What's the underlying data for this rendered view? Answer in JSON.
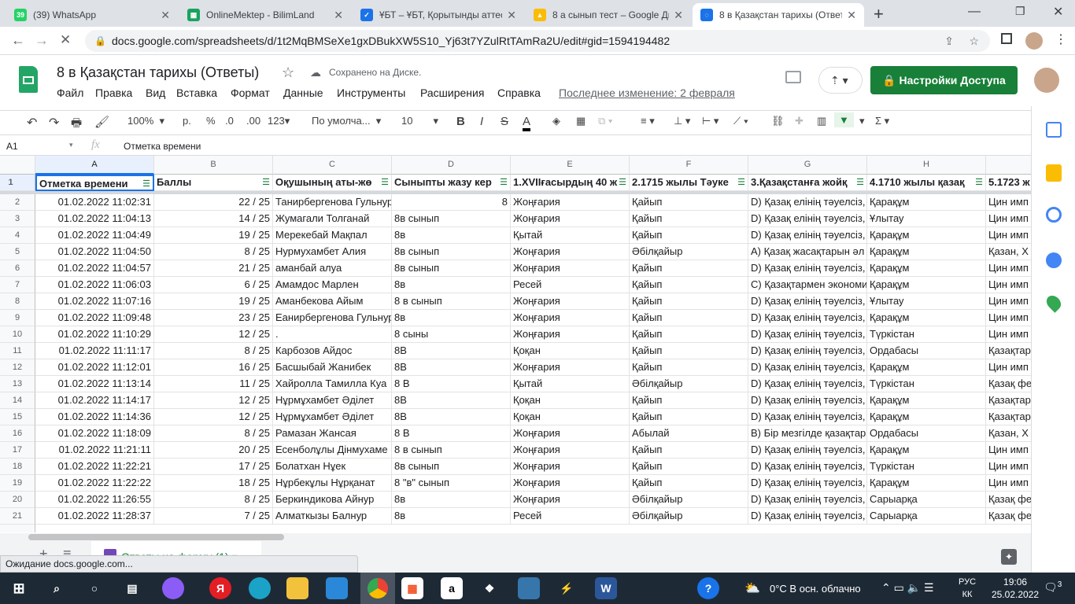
{
  "browser": {
    "tabs": [
      {
        "label": "(39) WhatsApp",
        "color": "#25d366",
        "glyph": "39"
      },
      {
        "label": "OnlineMektep - BilimLand",
        "color": "#1aa260",
        "glyph": "▦"
      },
      {
        "label": "ҰБТ – ҰБТ, Қорытынды аттес",
        "color": "#1a73e8",
        "glyph": "✓"
      },
      {
        "label": "8 а сынып тест – Google Ди",
        "color": "#fbbc04",
        "glyph": "▲"
      },
      {
        "label": "8 в Қазақстан тарихы (Ответ",
        "color": "#1a73e8",
        "glyph": "◌"
      }
    ],
    "url": "docs.google.com/spreadsheets/d/1t2MqBMSeXe1gxDBukXW5S10_Yj63t7YZulRtTAmRa2U/edit#gid=1594194482"
  },
  "doc": {
    "title": "8 в Қазақстан тарихы (Ответы)",
    "saved": "Сохранено на Диске.",
    "last_edit": "Последнее изменение: 2 февраля",
    "share": "Настройки Доступа",
    "menu": [
      "Файл",
      "Правка",
      "Вид",
      "Вставка",
      "Формат",
      "Данные",
      "Инструменты",
      "Расширения",
      "Справка"
    ]
  },
  "toolbar": {
    "zoom": "100%",
    "currency": "р.",
    "percent": "%",
    "dec_minus": ".0",
    "dec_plus": ".00",
    "format": "123",
    "font": "По умолча...",
    "size": "10",
    "bold": "B",
    "italic": "I",
    "strike": "S",
    "textcolor": "A"
  },
  "formula": {
    "cell": "A1",
    "fx": "fx",
    "value": "Отметка времени"
  },
  "columns": [
    "A",
    "B",
    "C",
    "D",
    "E",
    "F",
    "G",
    "H",
    "I"
  ],
  "headers": [
    "Отметка времени",
    "Баллы",
    "Оқушының аты-жө",
    "Сыныпты жазу  кер",
    "1.XVIIғасырдың 40 ж",
    "2.1715 жылы Тәуке",
    "3.Қазақстанға жойқ",
    "4.1710 жылы қазақ",
    "5.1723 ж"
  ],
  "rows": [
    [
      "2",
      "01.02.2022 11:02:31",
      "22 / 25",
      "Танирбергенова  Гульнур",
      "8",
      "Жоңғария",
      "Қайып",
      "D) Қазақ елінің тәуелсіз,",
      "Қарақұм",
      "Цин имп"
    ],
    [
      "3",
      "01.02.2022 11:04:13",
      "14 / 25",
      "Жумагали Толганай",
      "8в сынып",
      "Жоңғария",
      "Қайып",
      "D) Қазақ елінің тәуелсіз,",
      "Ұлытау",
      "Цин имп"
    ],
    [
      "4",
      "01.02.2022 11:04:49",
      "19 / 25",
      "Мерекебай Мақпал",
      "8в",
      "Қытай",
      "Қайып",
      "D) Қазақ елінің тәуелсіз,",
      "Қарақұм",
      "Цин имп"
    ],
    [
      "5",
      "01.02.2022 11:04:50",
      "8 / 25",
      "Нурмухамбет Алия",
      "8в сынып",
      "Жоңғария",
      "Әбілқайыр",
      "A) Қазақ жасақтарын әл",
      "Қарақұм",
      "Қазан, Х"
    ],
    [
      "6",
      "01.02.2022 11:04:57",
      "21 / 25",
      "аманбай алуа",
      "8в сынып",
      "Жоңғария",
      "Қайып",
      "D) Қазақ елінің тәуелсіз,",
      "Қарақұм",
      "Цин имп"
    ],
    [
      "7",
      "01.02.2022 11:06:03",
      "6 / 25",
      "Амамдос Марлен",
      "8в",
      "Ресей",
      "Қайып",
      "C) Қазақтармен экономи",
      "Қарақұм",
      "Цин имп"
    ],
    [
      "8",
      "01.02.2022 11:07:16",
      "19 / 25",
      "Аманбекова Айым",
      "8 в сынып",
      "Жоңғария",
      "Қайып",
      "D) Қазақ елінің тәуелсіз,",
      "Ұлытау",
      "Цин имп"
    ],
    [
      "9",
      "01.02.2022 11:09:48",
      "23 / 25",
      "Еанирбергенова Гульнур",
      "8в",
      "Жоңғария",
      "Қайып",
      "D) Қазақ елінің тәуелсіз,",
      "Қарақұм",
      "Цин имп"
    ],
    [
      "10",
      "01.02.2022 11:10:29",
      "12 / 25",
      ".",
      "8 сыны",
      "Жоңғария",
      "Қайып",
      "D) Қазақ елінің тәуелсіз,",
      "Түркістан",
      "Цин имп"
    ],
    [
      "11",
      "01.02.2022 11:11:17",
      "8 / 25",
      "Карбозов Айдос",
      "8В",
      "Қоқан",
      "Қайып",
      "D) Қазақ елінің тәуелсіз,",
      "Ордабасы",
      "Қазақтар"
    ],
    [
      "12",
      "01.02.2022 11:12:01",
      "16 / 25",
      "Басшыбай Жанибек",
      "8В",
      "Жоңғария",
      "Қайып",
      "D) Қазақ елінің тәуелсіз,",
      "Қарақұм",
      "Цин имп"
    ],
    [
      "13",
      "01.02.2022 11:13:14",
      "11 / 25",
      "Хайролла Тамилла Куа",
      "8 В",
      "Қытай",
      "Әбілқайыр",
      "D) Қазақ елінің тәуелсіз,",
      "Түркістан",
      "Қазақ фе"
    ],
    [
      "14",
      "01.02.2022 11:14:17",
      "12 / 25",
      "Нұрмұхамбет Әділет",
      "8В",
      "Қоқан",
      "Қайып",
      "D) Қазақ елінің тәуелсіз,",
      "Қарақұм",
      "Қазақтар"
    ],
    [
      "15",
      "01.02.2022 11:14:36",
      "12 / 25",
      "Нұрмұхамбет Әділет",
      "8В",
      "Қоқан",
      "Қайып",
      "D) Қазақ елінің тәуелсіз,",
      "Қарақұм",
      "Қазақтар"
    ],
    [
      "16",
      "01.02.2022 11:18:09",
      "8 / 25",
      "Рамазан Жансая",
      "8 В",
      "Жоңғария",
      "Абылай",
      "B) Бір мезгілде қазақтар",
      "Ордабасы",
      "Қазан, Х"
    ],
    [
      "17",
      "01.02.2022 11:21:11",
      "20 / 25",
      "Есенболұлы Дінмухаме",
      "8 в сынып",
      "Жоңғария",
      "Қайып",
      "D) Қазақ елінің тәуелсіз,",
      "Қарақұм",
      "Цин имп"
    ],
    [
      "18",
      "01.02.2022 11:22:21",
      "17 / 25",
      "Болатхан Нұек",
      "8в сынып",
      "Жоңғария",
      "Қайып",
      "D) Қазақ елінің тәуелсіз,",
      "Түркістан",
      "Цин имп"
    ],
    [
      "19",
      "01.02.2022 11:22:22",
      "18 / 25",
      "Нұрбекұлы Нұрқанат",
      "8 \"в\" сынып",
      "Жоңғария",
      "Қайып",
      "D) Қазақ елінің тәуелсіз,",
      "Қарақұм",
      "Цин имп"
    ],
    [
      "20",
      "01.02.2022 11:26:55",
      "8 / 25",
      "Беркиндикова Айнур",
      "8в",
      "Жоңғария",
      "Әбілқайыр",
      "D) Қазақ елінің тәуелсіз,",
      "Сарыарқа",
      "Қазақ фе"
    ],
    [
      "21",
      "01.02.2022 11:28:37",
      "7 / 25",
      "Алматкызы Балнур",
      "8в",
      "Ресей",
      "Әбілқайыр",
      "D) Қазақ елінің тәуелсіз,",
      "Сарыарқа",
      "Қазақ фе"
    ]
  ],
  "sheet_tab": "Ответы на форму (1)",
  "status": "Ожидание docs.google.com...",
  "tray": {
    "weather": "0°C  В осн. облачно",
    "lang1": "РУС",
    "lang2": "КК",
    "time": "19:06",
    "date": "25.02.2022",
    "notif": "3"
  }
}
